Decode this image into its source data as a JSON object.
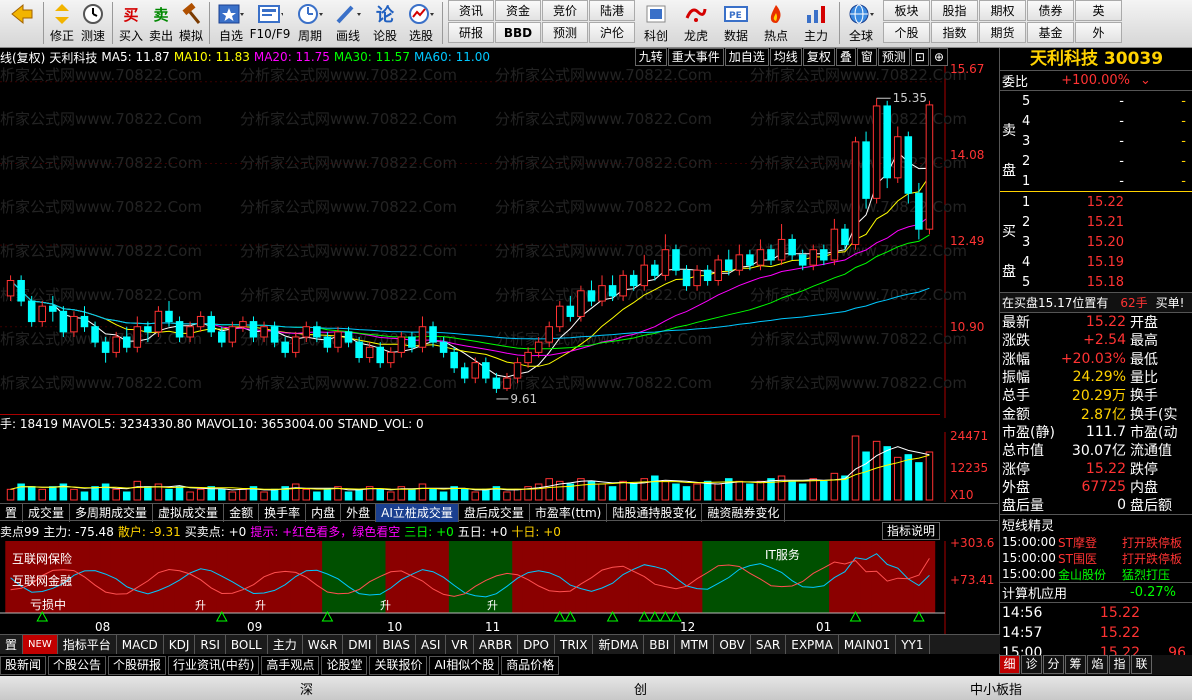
{
  "toolbar": {
    "buttons": [
      {
        "label": "",
        "icon": "back-arrow-icon",
        "color": "#e8a000"
      },
      {
        "label": "修正",
        "icon": "up-down-arrows-icon",
        "color": "#e8a000"
      },
      {
        "label": "测速",
        "icon": "clock-icon",
        "color": "#333333"
      },
      {
        "label": "买入",
        "icon": "buy-icon",
        "glyph": "买",
        "color": "#d40000"
      },
      {
        "label": "卖出",
        "icon": "sell-icon",
        "glyph": "卖",
        "color": "#008800"
      },
      {
        "label": "模拟",
        "icon": "hammer-icon",
        "color": "#b05000"
      },
      {
        "label": "自选",
        "icon": "star-icon",
        "color": "#2060c0"
      },
      {
        "label": "F10/F9",
        "icon": "document-icon",
        "color": "#2060c0"
      },
      {
        "label": "周期",
        "icon": "period-icon",
        "color": "#2060c0"
      },
      {
        "label": "画线",
        "icon": "pencil-icon",
        "color": "#2060c0"
      },
      {
        "label": "论股",
        "icon": "lun-icon",
        "glyph": "论",
        "color": "#2060c0"
      },
      {
        "label": "选股",
        "icon": "gauge-icon",
        "color": "#2060c0"
      }
    ],
    "grid1": [
      "资讯",
      "资金",
      "竞价",
      "陆港",
      "科创",
      "龙虎",
      "数据",
      "热点",
      "主力",
      "研报",
      "BBD",
      "预测",
      "沪伦",
      "科创",
      "龙虎",
      "数据",
      "热点",
      "主力"
    ],
    "grid1_top": [
      "资讯",
      "资金",
      "竞价",
      "陆港"
    ],
    "grid1_bottom": [
      "研报",
      "BBD",
      "预测",
      "沪伦"
    ],
    "iconbtns": [
      {
        "label": "科创",
        "icon": "kechuang-icon"
      },
      {
        "label": "龙虎",
        "icon": "dragon-icon"
      },
      {
        "label": "数据",
        "icon": "pe-icon"
      },
      {
        "label": "热点",
        "icon": "hot-icon"
      },
      {
        "label": "主力",
        "icon": "mainforce-icon"
      }
    ],
    "globe_label": "全球",
    "grid2_top": [
      "板块",
      "股指",
      "期权",
      "债券",
      "英"
    ],
    "grid2_bottom": [
      "个股",
      "指数",
      "期货",
      "基金",
      "外"
    ]
  },
  "chart": {
    "header": {
      "prefix": "线(复权)",
      "name": "天利科技",
      "ma5": "MA5: 11.87",
      "ma10": "MA10: 11.83",
      "ma20": "MA20: 11.75",
      "ma30": "MA30: 11.57",
      "ma60": "MA60: 11.00"
    },
    "tools": [
      "九转",
      "重大事件",
      "加自选",
      "均线",
      "复权",
      "叠",
      "窗",
      "预测",
      "⊡",
      "⊕"
    ],
    "price_labels": [
      "15.67",
      "14.08",
      "12.49",
      "10.90"
    ],
    "high_marker": "15.35",
    "low_marker": "9.61",
    "watermark": "分析家公式网www.70822.Com",
    "vol_header": {
      "vol": "手: 18419",
      "mavol5": "MAVOL5: 3234330.80",
      "mavol10": "MAVOL10: 3653004.00",
      "stand": "STAND_VOL: 0"
    },
    "vol_labels": [
      "24471",
      "12235",
      "X10"
    ],
    "tabs": [
      "置",
      "成交量",
      "多周期成交量",
      "虚拟成交量",
      "金额",
      "换手率",
      "内盘",
      "外盘",
      "AI立桩成交量",
      "盘后成交量",
      "市盈率(ttm)",
      "陆股通持股变化",
      "融资融券变化"
    ],
    "active_tab": "AI立桩成交量",
    "ind_header": {
      "a": "卖点99",
      "b": "主力: -75.48",
      "c": "散户: -9.31",
      "d": "买卖点: +0",
      "e": "提示: +红色看多，绿色看空",
      "f": "三日: +0",
      "g": "五日: +0",
      "h": "十日: +0"
    },
    "ind_button": "指标说明",
    "ind_labels": [
      "+303.6",
      "+73.41"
    ],
    "ind_texts": [
      "互联网保险",
      "互联网金融",
      "IT服务",
      "亏损中",
      "升",
      "升",
      "升",
      "升"
    ],
    "month_labels": [
      "08",
      "09",
      "10",
      "11",
      "12",
      "01"
    ],
    "colors": {
      "up": "#ff3232",
      "down": "#00ffff",
      "ma5": "#ffffff",
      "ma10": "#ffff00",
      "ma20": "#ff00ff",
      "ma30": "#00ff00",
      "ma60": "#00c8ff",
      "panel_red": "#8b0000",
      "panel_green": "#005000"
    }
  },
  "chart_data": {
    "type": "candlestick",
    "title": "天利科技",
    "ylim": [
      9.2,
      15.9
    ],
    "candles": [
      [
        11.5,
        11.8,
        11.4,
        11.9
      ],
      [
        11.8,
        11.4,
        11.3,
        11.9
      ],
      [
        11.4,
        11.0,
        10.9,
        11.5
      ],
      [
        11.0,
        11.3,
        10.9,
        11.4
      ],
      [
        11.3,
        11.2,
        11.0,
        11.5
      ],
      [
        11.2,
        10.8,
        10.7,
        11.3
      ],
      [
        10.8,
        11.1,
        10.7,
        11.2
      ],
      [
        11.1,
        10.9,
        10.8,
        11.3
      ],
      [
        10.9,
        10.6,
        10.5,
        11.0
      ],
      [
        10.6,
        10.4,
        10.2,
        10.7
      ],
      [
        10.4,
        10.7,
        10.3,
        10.8
      ],
      [
        10.7,
        10.5,
        10.4,
        10.9
      ],
      [
        10.5,
        10.9,
        10.4,
        11.1
      ],
      [
        10.9,
        10.8,
        10.6,
        11.0
      ],
      [
        10.8,
        11.2,
        10.7,
        11.3
      ],
      [
        11.2,
        11.0,
        10.9,
        11.4
      ],
      [
        11.0,
        10.7,
        10.6,
        11.1
      ],
      [
        10.7,
        10.9,
        10.6,
        11.0
      ],
      [
        10.9,
        11.1,
        10.8,
        11.2
      ],
      [
        11.1,
        10.8,
        10.7,
        11.2
      ],
      [
        10.8,
        10.6,
        10.5,
        10.9
      ],
      [
        10.6,
        10.9,
        10.5,
        11.0
      ],
      [
        10.9,
        11.0,
        10.8,
        11.1
      ],
      [
        11.0,
        10.7,
        10.6,
        11.1
      ],
      [
        10.7,
        10.9,
        10.6,
        11.0
      ],
      [
        10.9,
        10.6,
        10.5,
        11.0
      ],
      [
        10.6,
        10.4,
        10.3,
        10.7
      ],
      [
        10.4,
        10.7,
        10.3,
        10.8
      ],
      [
        10.7,
        10.9,
        10.6,
        11.0
      ],
      [
        10.9,
        10.7,
        10.6,
        11.0
      ],
      [
        10.7,
        10.5,
        10.4,
        10.8
      ],
      [
        10.5,
        10.8,
        10.4,
        10.9
      ],
      [
        10.8,
        10.6,
        10.5,
        10.9
      ],
      [
        10.6,
        10.3,
        10.2,
        10.7
      ],
      [
        10.3,
        10.5,
        10.2,
        10.6
      ],
      [
        10.5,
        10.2,
        10.1,
        10.6
      ],
      [
        10.2,
        10.4,
        10.1,
        10.5
      ],
      [
        10.4,
        10.7,
        10.3,
        10.8
      ],
      [
        10.7,
        10.5,
        10.4,
        10.8
      ],
      [
        10.5,
        10.9,
        10.4,
        11.1
      ],
      [
        10.9,
        10.6,
        10.5,
        11.0
      ],
      [
        10.6,
        10.4,
        10.3,
        10.7
      ],
      [
        10.4,
        10.1,
        10.0,
        10.5
      ],
      [
        10.1,
        9.9,
        9.8,
        10.2
      ],
      [
        9.9,
        10.2,
        9.8,
        10.3
      ],
      [
        10.2,
        9.9,
        9.8,
        10.3
      ],
      [
        9.9,
        9.7,
        9.61,
        10.0
      ],
      [
        9.7,
        9.9,
        9.65,
        10.0
      ],
      [
        9.9,
        10.2,
        9.8,
        10.3
      ],
      [
        10.2,
        10.4,
        10.1,
        10.5
      ],
      [
        10.4,
        10.6,
        10.3,
        10.7
      ],
      [
        10.6,
        10.9,
        10.5,
        11.0
      ],
      [
        10.9,
        11.3,
        10.8,
        11.4
      ],
      [
        11.3,
        11.1,
        11.0,
        11.5
      ],
      [
        11.1,
        11.6,
        11.0,
        11.7
      ],
      [
        11.6,
        11.4,
        11.3,
        11.8
      ],
      [
        11.4,
        11.7,
        11.3,
        11.9
      ],
      [
        11.7,
        11.5,
        11.4,
        11.9
      ],
      [
        11.5,
        11.9,
        11.4,
        12.0
      ],
      [
        11.9,
        11.7,
        11.6,
        12.0
      ],
      [
        11.7,
        12.1,
        11.6,
        12.3
      ],
      [
        12.1,
        11.9,
        11.8,
        12.2
      ],
      [
        11.9,
        12.4,
        11.8,
        12.7
      ],
      [
        12.4,
        12.0,
        11.9,
        12.5
      ],
      [
        12.0,
        11.7,
        11.6,
        12.1
      ],
      [
        11.7,
        12.0,
        11.6,
        12.1
      ],
      [
        12.0,
        11.8,
        11.7,
        12.1
      ],
      [
        11.8,
        12.2,
        11.7,
        12.3
      ],
      [
        12.2,
        12.0,
        11.9,
        12.4
      ],
      [
        12.0,
        12.3,
        11.9,
        12.5
      ],
      [
        12.3,
        12.1,
        12.0,
        12.4
      ],
      [
        12.1,
        12.4,
        12.0,
        12.6
      ],
      [
        12.4,
        12.2,
        12.1,
        12.5
      ],
      [
        12.2,
        12.6,
        12.1,
        12.9
      ],
      [
        12.6,
        12.3,
        12.2,
        12.7
      ],
      [
        12.3,
        12.1,
        12.0,
        12.4
      ],
      [
        12.1,
        12.4,
        12.0,
        12.5
      ],
      [
        12.4,
        12.2,
        12.1,
        12.5
      ],
      [
        12.2,
        12.8,
        12.1,
        13.0
      ],
      [
        12.8,
        12.5,
        12.4,
        12.9
      ],
      [
        12.5,
        14.5,
        12.4,
        14.6
      ],
      [
        14.5,
        13.4,
        13.2,
        14.7
      ],
      [
        13.4,
        15.2,
        13.3,
        15.35
      ],
      [
        15.2,
        13.8,
        13.6,
        15.3
      ],
      [
        13.8,
        14.6,
        13.7,
        14.8
      ],
      [
        14.6,
        13.5,
        13.3,
        14.7
      ],
      [
        13.5,
        12.8,
        12.6,
        13.7
      ],
      [
        12.8,
        15.22,
        12.7,
        15.3
      ]
    ],
    "volumes": [
      4,
      6,
      5,
      4,
      5,
      6,
      4,
      3,
      5,
      6,
      4,
      3,
      7,
      5,
      6,
      4,
      5,
      3,
      4,
      5,
      4,
      3,
      4,
      5,
      3,
      4,
      5,
      6,
      4,
      3,
      4,
      5,
      3,
      4,
      5,
      4,
      3,
      5,
      4,
      6,
      4,
      3,
      5,
      4,
      3,
      4,
      5,
      3,
      4,
      5,
      6,
      8,
      7,
      6,
      8,
      7,
      6,
      5,
      7,
      6,
      8,
      9,
      7,
      6,
      5,
      6,
      7,
      6,
      8,
      7,
      6,
      7,
      8,
      9,
      7,
      6,
      8,
      7,
      10,
      9,
      24,
      18,
      22,
      20,
      16,
      17,
      14,
      18
    ],
    "ma_labels": [
      "MA5",
      "MA10",
      "MA20",
      "MA30",
      "MA60"
    ]
  },
  "right": {
    "title": "天利科技 30039",
    "weibi_label": "委比",
    "weibi_value": "+100.00%",
    "sell_label": "卖盘",
    "buy_label": "买盘",
    "sell": [
      {
        "lvl": "5",
        "price": "-",
        "vol": "-"
      },
      {
        "lvl": "4",
        "price": "-",
        "vol": "-"
      },
      {
        "lvl": "3",
        "price": "-",
        "vol": "-"
      },
      {
        "lvl": "2",
        "price": "-",
        "vol": "-"
      },
      {
        "lvl": "1",
        "price": "-",
        "vol": "-"
      }
    ],
    "buy": [
      {
        "lvl": "1",
        "price": "15.22",
        "vol": ""
      },
      {
        "lvl": "2",
        "price": "15.21",
        "vol": ""
      },
      {
        "lvl": "3",
        "price": "15.20",
        "vol": ""
      },
      {
        "lvl": "4",
        "price": "15.19",
        "vol": ""
      },
      {
        "lvl": "5",
        "price": "15.18",
        "vol": ""
      }
    ],
    "inbuy_text": "在买盘15.17位置有",
    "inbuy_vol": "62手",
    "inbuy_btn": "买单!",
    "quotes": [
      {
        "l": "最新",
        "v": "15.22",
        "r": "开盘"
      },
      {
        "l": "涨跌",
        "v": "+2.54",
        "r": "最高"
      },
      {
        "l": "涨幅",
        "v": "+20.03%",
        "r": "最低"
      },
      {
        "l": "振幅",
        "v": "24.29%",
        "r": "量比"
      },
      {
        "l": "总手",
        "v": "20.29万",
        "r": "换手"
      },
      {
        "l": "金额",
        "v": "2.87亿",
        "r": "换手(实"
      },
      {
        "l": "市盈(静)",
        "v": "111.7",
        "r": "市盈(动"
      },
      {
        "l": "总市值",
        "v": "30.07亿",
        "r": "流通值"
      },
      {
        "l": "涨停",
        "v": "15.22",
        "r": "跌停"
      },
      {
        "l": "外盘",
        "v": "67725",
        "r": "内盘"
      },
      {
        "l": "盘后量",
        "v": "0",
        "r": "盘后额"
      }
    ],
    "sprite_title": "短线精灵",
    "sprites": [
      {
        "t": "15:00:00",
        "n": "ST摩登",
        "e": "打开跌停板"
      },
      {
        "t": "15:00:00",
        "n": "ST围医",
        "e": "打开跌停板"
      },
      {
        "t": "15:00:00",
        "n": "金山股份",
        "e": "猛烈打压"
      }
    ],
    "sector": {
      "name": "计算机应用",
      "chg": "-0.27%"
    },
    "ticks": [
      {
        "t": "14:56",
        "p": "15.22",
        "v": ""
      },
      {
        "t": "14:57",
        "p": "15.22",
        "v": ""
      },
      {
        "t": "15:00",
        "p": "15.22",
        "v": "96"
      }
    ]
  },
  "bottom": {
    "tabs": [
      "置",
      "NEW",
      "指标平台",
      "MACD",
      "KDJ",
      "RSI",
      "BOLL",
      "主力",
      "W&R",
      "DMI",
      "BIAS",
      "ASI",
      "VR",
      "ARBR",
      "DPO",
      "TRIX",
      "新DMA",
      "BBI",
      "MTM",
      "OBV",
      "SAR",
      "EXPMA",
      "MAIN01",
      "YY1"
    ],
    "news": [
      "股新闻",
      "个股公告",
      "个股研报",
      "行业资讯(中药)",
      "高手观点",
      "论股堂",
      "关联报价",
      "AI相似个股",
      "商品价格"
    ],
    "rp_tabs": [
      "细",
      "诊",
      "分",
      "筹",
      "焰",
      "指",
      "联"
    ],
    "status": [
      "深",
      "创",
      "中小板指"
    ]
  }
}
